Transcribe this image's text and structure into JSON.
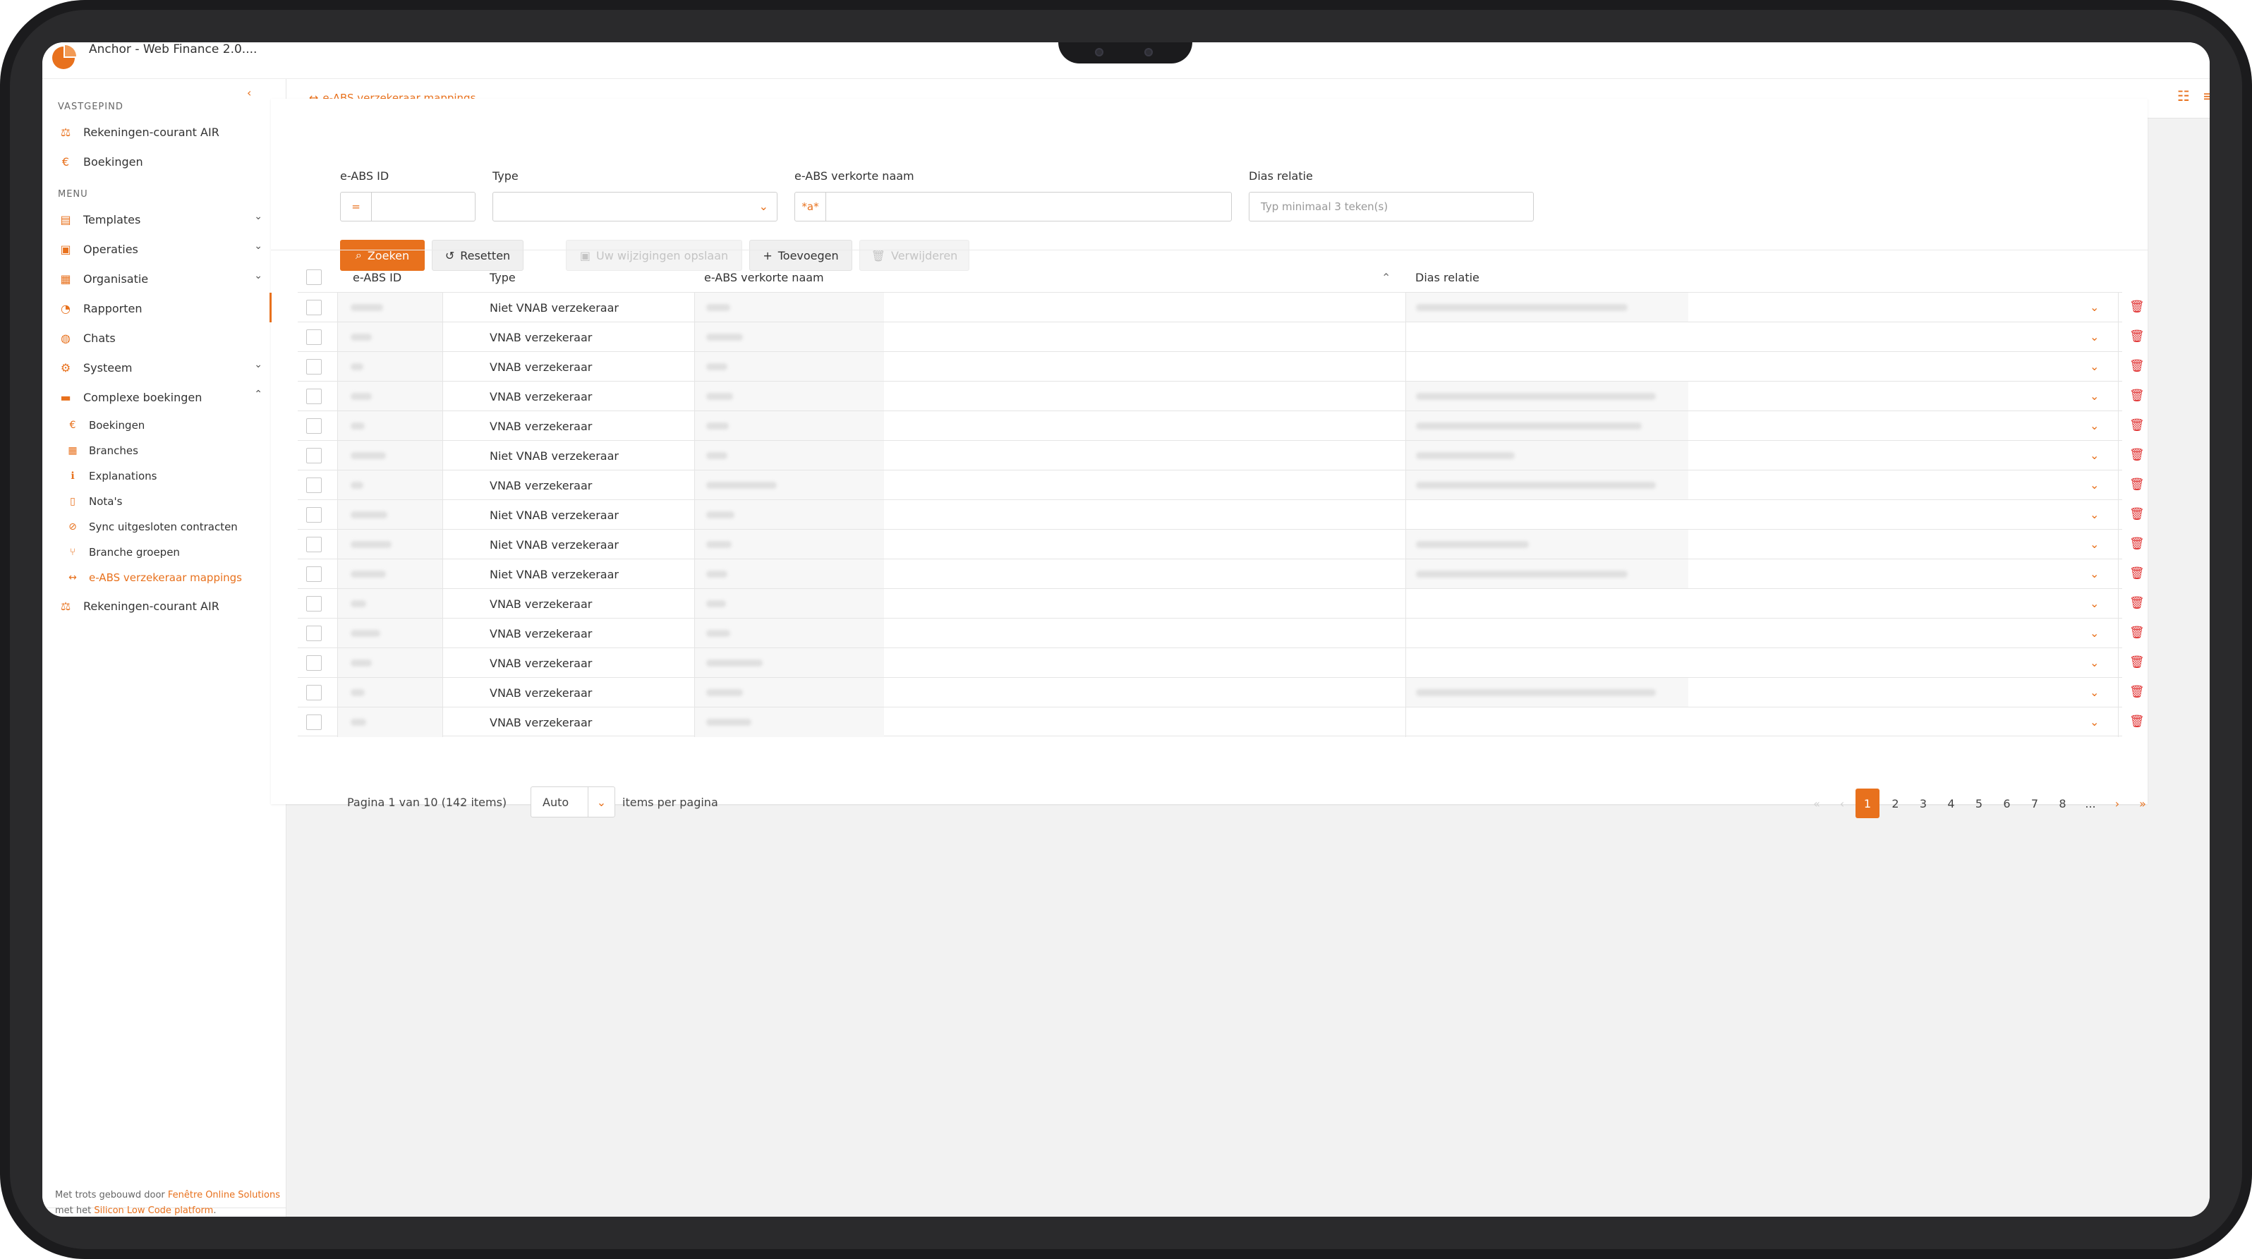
{
  "app": {
    "title": "Anchor - Web Finance 2.0...."
  },
  "sidebar": {
    "collapse_icon": "chevron-left-icon",
    "pinned_label": "VASTGEPIND",
    "pinned": [
      {
        "label": "Rekeningen-courant AIR",
        "icon": "scale-icon"
      },
      {
        "label": "Boekingen",
        "icon": "euro-icon"
      }
    ],
    "menu_label": "MENU",
    "menu": [
      {
        "label": "Templates",
        "icon": "templates-icon"
      },
      {
        "label": "Operaties",
        "icon": "operations-icon"
      },
      {
        "label": "Organisatie",
        "icon": "organization-icon"
      },
      {
        "label": "Rapporten",
        "icon": "reports-icon"
      },
      {
        "label": "Chats",
        "icon": "chat-icon"
      },
      {
        "label": "Systeem",
        "icon": "system-icon"
      },
      {
        "label": "Complexe boekingen",
        "icon": "complex-bookings-icon"
      }
    ],
    "submenu": [
      {
        "label": "Boekingen",
        "icon": "euro-icon"
      },
      {
        "label": "Branches",
        "icon": "grid-icon"
      },
      {
        "label": "Explanations",
        "icon": "info-icon"
      },
      {
        "label": "Nota's",
        "icon": "note-icon"
      },
      {
        "label": "Sync uitgesloten contracten",
        "icon": "sync-icon"
      },
      {
        "label": "Branche groepen",
        "icon": "branch-icon"
      },
      {
        "label": "e-ABS verzekeraar mappings",
        "icon": "swap-icon"
      }
    ],
    "bottom_item": {
      "label": "Rekeningen-courant AIR",
      "icon": "scale-icon"
    },
    "footer": {
      "prefix": "Met trots gebouwd door ",
      "company": "Fenêtre Online Solutions",
      "middle": " met het ",
      "platform": "Silicon Low Code platform",
      "suffix": "."
    }
  },
  "tabs": [
    {
      "label": "e-ABS verzekeraar mappings",
      "icon": "swap-icon"
    }
  ],
  "filters": {
    "eabs_id": {
      "label": "e-ABS ID",
      "operator": "="
    },
    "type": {
      "label": "Type",
      "value": ""
    },
    "short_name": {
      "label": "e-ABS verkorte naam",
      "operator": "*a*"
    },
    "dias": {
      "label": "Dias relatie",
      "placeholder": "Typ minimaal 3 teken(s)"
    }
  },
  "toolbar": {
    "search": "Zoeken",
    "reset": "Resetten",
    "save": "Uw wijzigingen opslaan",
    "add": "Toevoegen",
    "delete": "Verwijderen"
  },
  "table": {
    "columns": [
      "e-ABS ID",
      "Type",
      "e-ABS verkorte naam",
      "Dias relatie"
    ],
    "rows": [
      {
        "type": "Niet VNAB verzekeraar",
        "has_dias": true
      },
      {
        "type": "VNAB verzekeraar",
        "has_dias": false
      },
      {
        "type": "VNAB verzekeraar",
        "has_dias": false
      },
      {
        "type": "VNAB verzekeraar",
        "has_dias": true
      },
      {
        "type": "VNAB verzekeraar",
        "has_dias": true
      },
      {
        "type": "Niet VNAB verzekeraar",
        "has_dias": true
      },
      {
        "type": "VNAB verzekeraar",
        "has_dias": true
      },
      {
        "type": "Niet VNAB verzekeraar",
        "has_dias": false
      },
      {
        "type": "Niet VNAB verzekeraar",
        "has_dias": true
      },
      {
        "type": "Niet VNAB verzekeraar",
        "has_dias": true
      },
      {
        "type": "VNAB verzekeraar",
        "has_dias": false
      },
      {
        "type": "VNAB verzekeraar",
        "has_dias": false
      },
      {
        "type": "VNAB verzekeraar",
        "has_dias": false
      },
      {
        "type": "VNAB verzekeraar",
        "has_dias": true
      },
      {
        "type": "VNAB verzekeraar",
        "has_dias": false
      }
    ]
  },
  "pagination": {
    "summary": "Pagina 1 van 10 (142 items)",
    "page_size": "Auto",
    "per_page_label": "items per pagina",
    "pages": [
      "1",
      "2",
      "3",
      "4",
      "5",
      "6",
      "7",
      "8",
      "..."
    ],
    "current": "1"
  },
  "colors": {
    "accent": "#e8711d",
    "danger": "#e03030"
  }
}
